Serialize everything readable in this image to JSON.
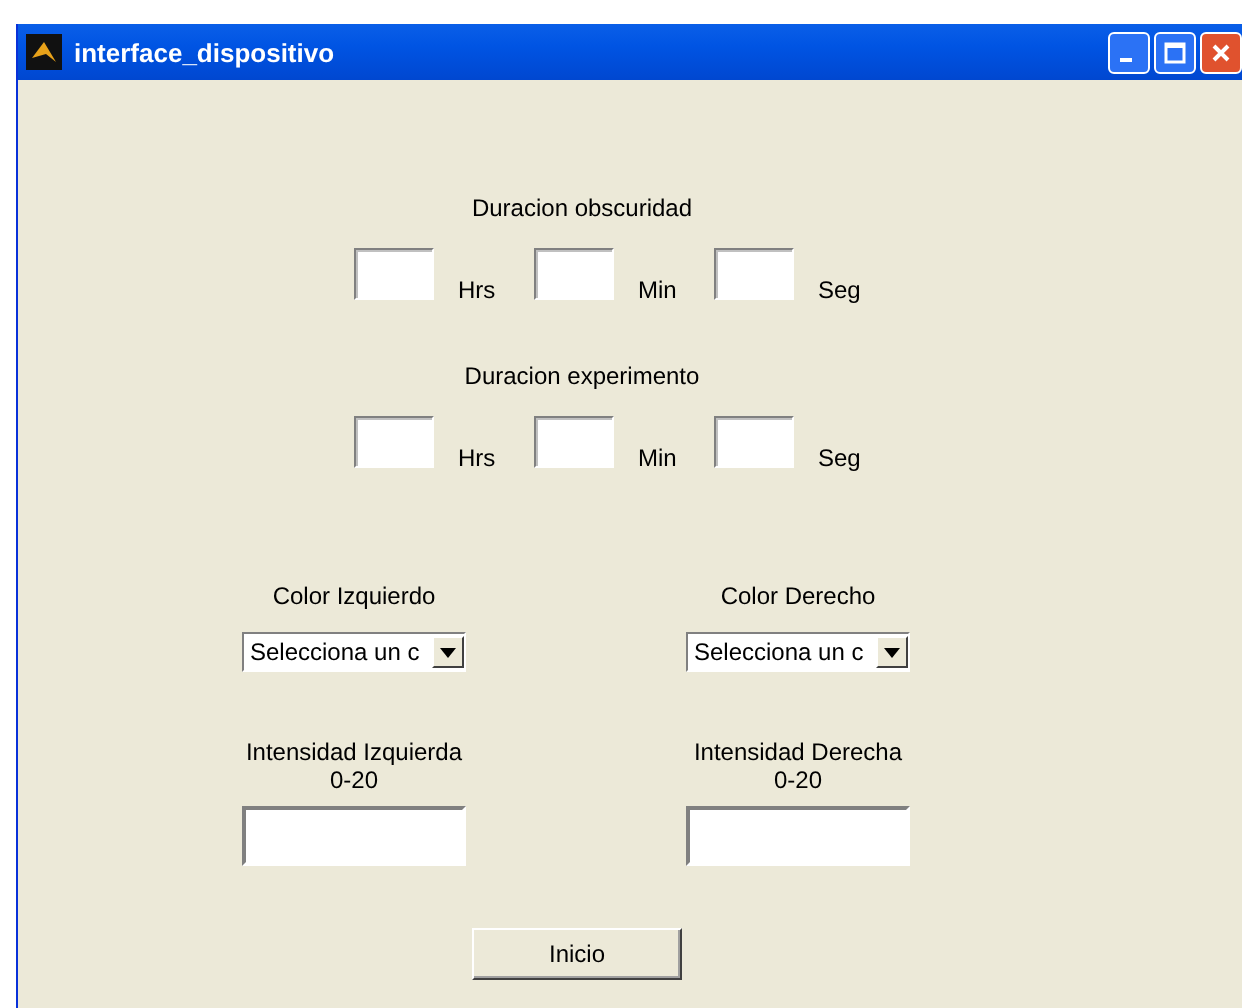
{
  "window": {
    "title": "interface_dispositivo"
  },
  "duration_groups": [
    {
      "title": "Duracion obscuridad",
      "fields": [
        {
          "unit": "Hrs"
        },
        {
          "unit": "Min"
        },
        {
          "unit": "Seg"
        }
      ]
    },
    {
      "title": "Duracion experimento",
      "fields": [
        {
          "unit": "Hrs"
        },
        {
          "unit": "Min"
        },
        {
          "unit": "Seg"
        }
      ]
    }
  ],
  "color_selectors": [
    {
      "label": "Color Izquierdo",
      "value": "Selecciona un c"
    },
    {
      "label": "Color Derecho",
      "value": "Selecciona un c"
    }
  ],
  "intensity_fields": [
    {
      "label": "Intensidad Izquierda",
      "range": "0-20"
    },
    {
      "label": "Intensidad Derecha",
      "range": "0-20"
    }
  ],
  "start_button": "Inicio"
}
